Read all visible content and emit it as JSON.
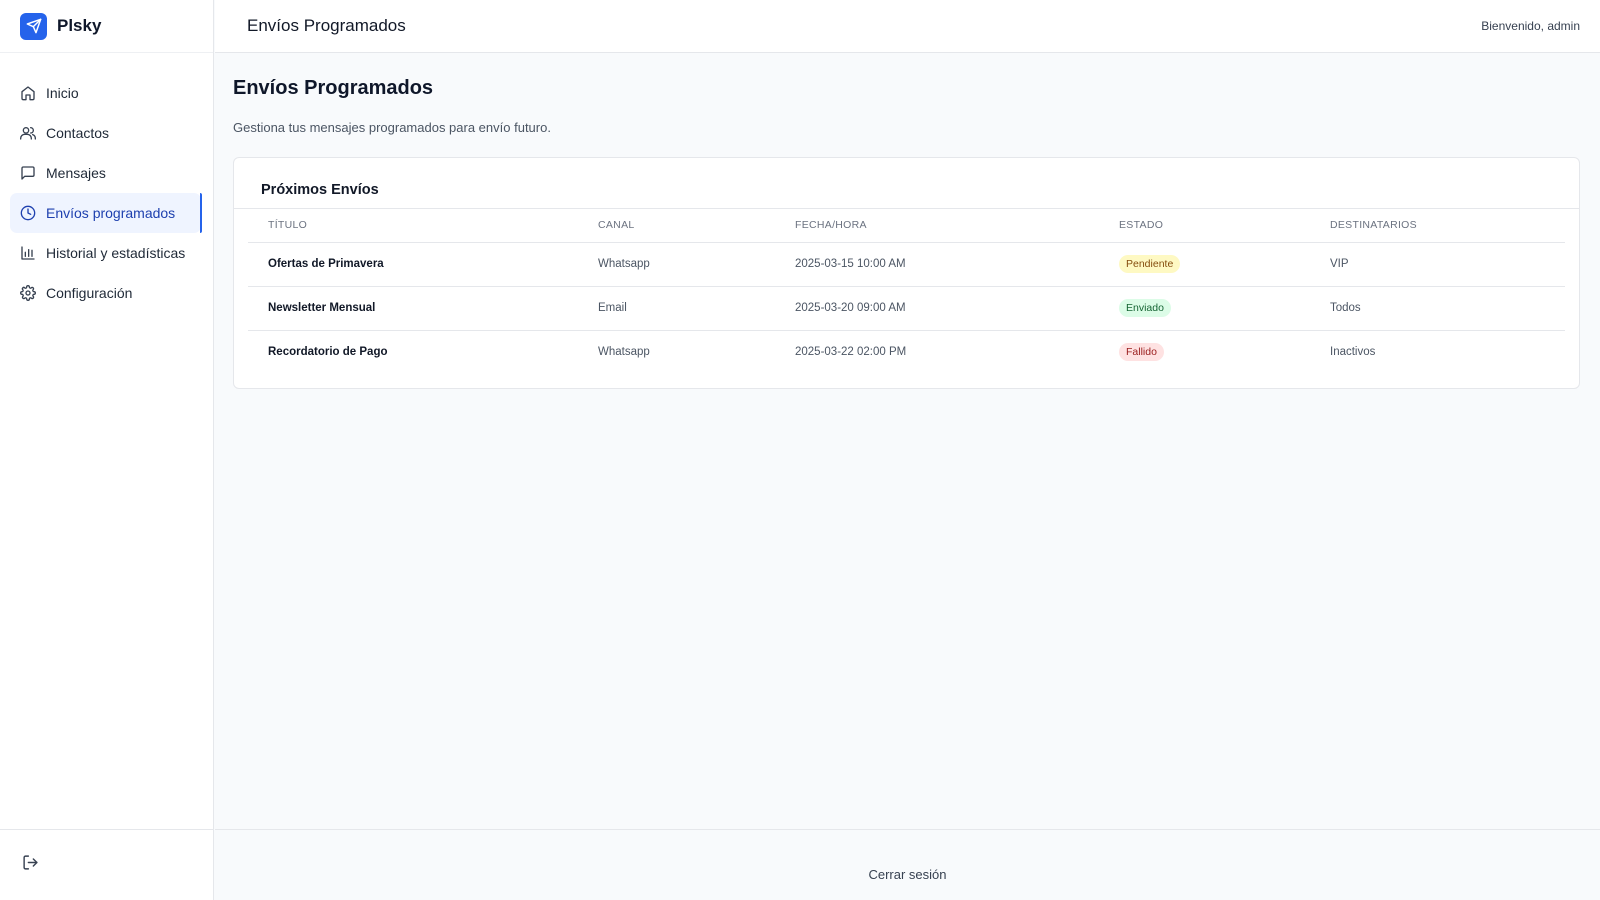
{
  "brand": {
    "name": "Plsky"
  },
  "sidebar": {
    "items": [
      {
        "label": "Inicio",
        "icon": "home-icon"
      },
      {
        "label": "Contactos",
        "icon": "users-icon"
      },
      {
        "label": "Mensajes",
        "icon": "message-icon"
      },
      {
        "label": "Envíos programados",
        "icon": "clock-icon",
        "active": true
      },
      {
        "label": "Historial y estadísticas",
        "icon": "bar-chart-icon"
      },
      {
        "label": "Configuración",
        "icon": "gear-icon"
      }
    ],
    "footer_icon": "logout-icon"
  },
  "header": {
    "title": "Envíos Programados",
    "user_greeting": "Bienvenido, admin"
  },
  "main": {
    "title": "Envíos Programados",
    "subtitle": "Gestiona tus mensajes programados para envío futuro.",
    "card": {
      "title": "Próximos Envíos",
      "columns": [
        "TÍTULO",
        "CANAL",
        "FECHA/HORA",
        "ESTADO",
        "DESTINATARIOS"
      ],
      "rows": [
        {
          "title": "Ofertas de Primavera",
          "channel": "Whatsapp",
          "datetime": "2025-03-15 10:00 AM",
          "status": "Pendiente",
          "recipients": "VIP"
        },
        {
          "title": "Newsletter Mensual",
          "channel": "Email",
          "datetime": "2025-03-20 09:00 AM",
          "status": "Enviado",
          "recipients": "Todos"
        },
        {
          "title": "Recordatorio de Pago",
          "channel": "Whatsapp",
          "datetime": "2025-03-22 02:00 PM",
          "status": "Fallido",
          "recipients": "Inactivos"
        }
      ]
    }
  },
  "footer": {
    "logout_label": "Cerrar sesión"
  },
  "colors": {
    "accent": "#2563eb",
    "status_pending": "#fef9c3",
    "status_sent": "#dcfce7",
    "status_failed": "#fee2e2"
  }
}
